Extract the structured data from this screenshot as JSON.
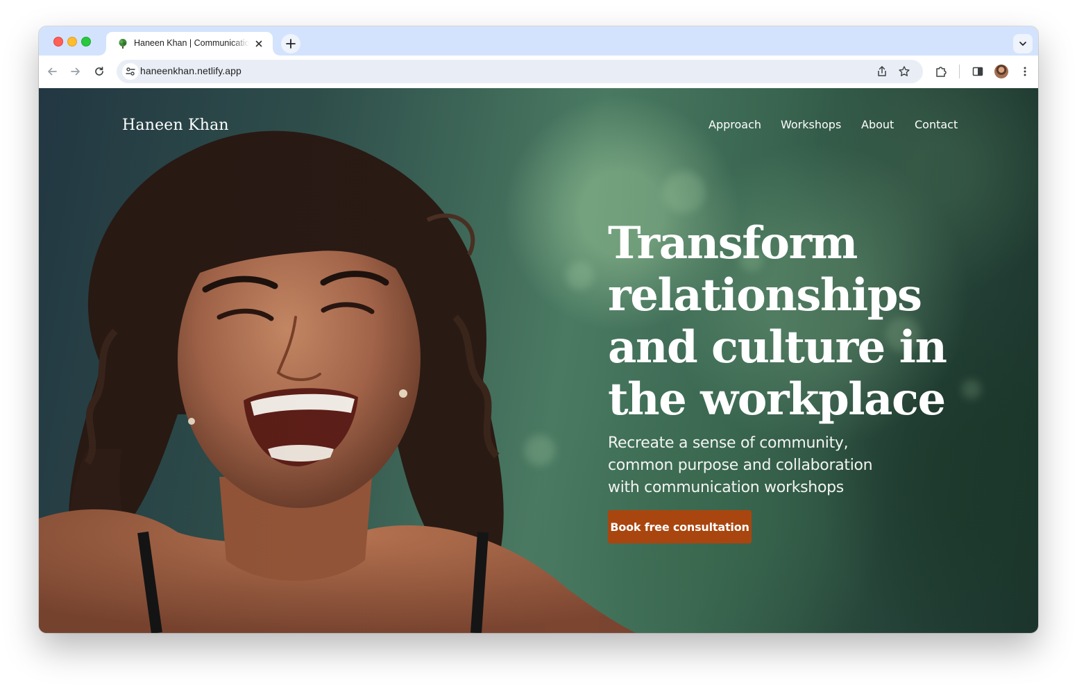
{
  "browser": {
    "tab_title": "Haneen Khan | Communication Workshops",
    "url": "haneenkhan.netlify.app",
    "favicon": "tree-icon",
    "icons": [
      "back-arrow-icon",
      "forward-arrow-icon",
      "reload-icon",
      "site-info-icon",
      "share-icon",
      "bookmark-star-icon",
      "extensions-icon",
      "side-panel-icon",
      "profile-avatar",
      "menu-kebab-icon",
      "new-tab-plus-icon",
      "tab-search-chevron-icon",
      "close-icon"
    ]
  },
  "site": {
    "brand": "Haneen Khan",
    "nav": [
      "Approach",
      "Workshops",
      "About",
      "Contact"
    ],
    "hero": {
      "headline": "Transform relationships and culture in the workplace",
      "subhead": "Recreate a sense of community, common purpose and collaboration with communication workshops",
      "cta": "Book free consultation"
    }
  },
  "colors": {
    "cta": "#a9460f",
    "tabstrip": "#d3e3fd",
    "omnibox": "#e9eef6"
  }
}
